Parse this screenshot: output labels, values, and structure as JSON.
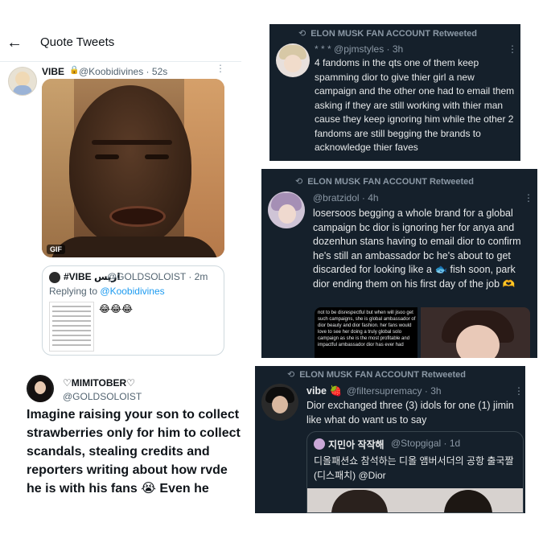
{
  "left_panel": {
    "title": "Quote Tweets",
    "back_icon": "back-arrow-icon",
    "tweet": {
      "name": "VIBE",
      "handle_time": "@Koobidivines · 52s",
      "media_label": "GIF",
      "quoted": {
        "name": "#VIBE اريس",
        "handle_time": "@GOLDSOLOIST · 2m",
        "reply_prefix": "Replying to",
        "reply_to": "@Koobidivines",
        "emoji": "😂😂😂"
      }
    },
    "second_tweet": {
      "name": "♡MIMITOBER♡",
      "handle": "@GOLDSOLOIST",
      "text": "Imagine raising your son to collect strawberries only for him to collect scandals, stealing credits and reporters writing about how rvde he is with his fans 😭 Even he"
    }
  },
  "cards": [
    {
      "retweet_label": "ELON MUSK FAN ACCOUNT Retweeted",
      "handle": "* * * @pjmstyles · 3h",
      "text": "4 fandoms in the qts one of them keep spamming dior to give thier girl a new campaign and the other one had to email them asking if they are still working with thier man cause they keep ignoring him while the other 2 fandoms are still begging the brands to acknowledge thier faves"
    },
    {
      "retweet_label": "ELON MUSK FAN ACCOUNT Retweeted",
      "handle": "@bratzidol · 4h",
      "text": "losersoos begging a whole brand for a global campaign bc dior is ignoring her for anya and dozenhun stans having to email dior to confirm he's still an ambassador bc he's about to get discarded for looking like a 🐟 fish soon, park dior ending them on his first day of the job 🫶",
      "image_text": "not to be disrespectful but when will jisoo get such campaigns, she is global ambassador of dior beauty and dior fashion. her fans would love to see her doing a truly global solo campaign as she is the most profitable and impactful ambassador dior has ever had"
    },
    {
      "retweet_label": "ELON MUSK FAN ACCOUNT Retweeted",
      "name": "vibe 🍓",
      "handle": "@filtersupremacy · 3h",
      "text": "Dior exchanged three (3) idols for one (1) jimin like what do want us to say",
      "quoted": {
        "name": "지민아 작작해",
        "handle_time": "@Stopgigal · 1d",
        "text": "디올패션쇼 참석하는 디올 앰버서더의 공항 출국짤 (디스패치) @Dior"
      }
    }
  ],
  "icons": {
    "retweet": "⟲",
    "more": "⋮",
    "lock": "🔒"
  },
  "colors": {
    "dark_bg": "#15202b",
    "link_blue": "#1d9bf0",
    "muted": "#8b98a5"
  }
}
